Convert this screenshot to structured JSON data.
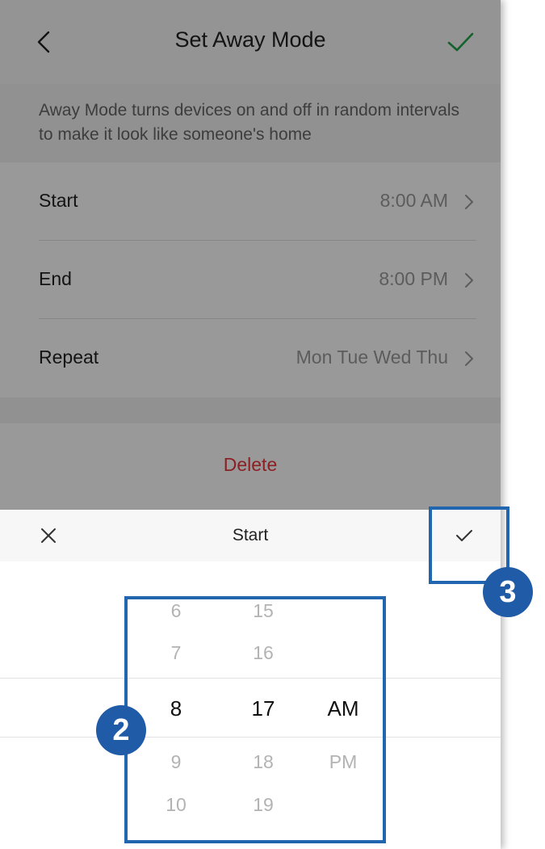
{
  "header": {
    "title": "Set Away Mode",
    "back_icon": "chevron-left-icon",
    "confirm_icon": "checkmark-icon",
    "confirm_color": "#1fa34a"
  },
  "description": "Away Mode turns devices on and off in random intervals to make it look like someone's home",
  "settings": [
    {
      "label": "Start",
      "value": "8:00 AM"
    },
    {
      "label": "End",
      "value": "8:00 PM"
    },
    {
      "label": "Repeat",
      "value": "Mon Tue Wed Thu"
    }
  ],
  "delete_label": "Delete",
  "delete_color": "#e8373d",
  "picker_sheet": {
    "title": "Start",
    "close_icon": "close-icon",
    "confirm_icon": "checkmark-icon",
    "hours": [
      "6",
      "7",
      "8",
      "9",
      "10"
    ],
    "minutes": [
      "15",
      "16",
      "17",
      "18",
      "19"
    ],
    "periods": [
      "AM",
      "PM"
    ],
    "selected": {
      "hour": "8",
      "minute": "17",
      "period": "AM"
    }
  },
  "annotations": {
    "badge_picker": "2",
    "badge_confirm": "3",
    "color": "#2266b0"
  }
}
